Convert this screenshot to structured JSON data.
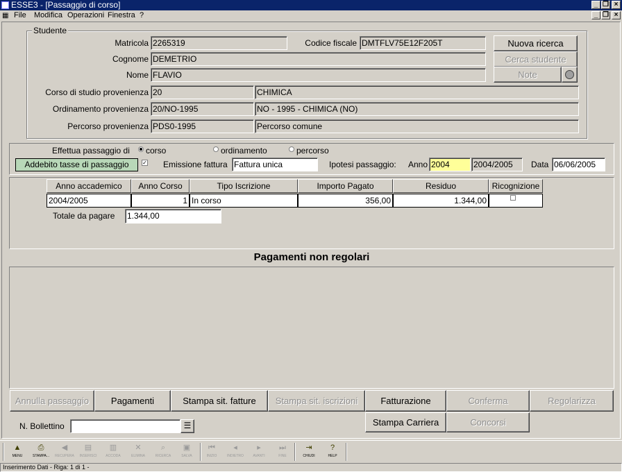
{
  "window": {
    "title": "ESSE3 - [Passaggio di corso]"
  },
  "menu": {
    "items": [
      "File",
      "Modifica",
      "Operazioni",
      "Finestra",
      "?"
    ]
  },
  "studente": {
    "legend": "Studente",
    "matricola_label": "Matricola",
    "matricola": "2265319",
    "cf_label": "Codice fiscale",
    "cf": "DMTFLV75E12F205T",
    "cognome_label": "Cognome",
    "cognome": "DEMETRIO",
    "nome_label": "Nome",
    "nome": "FLAVIO",
    "corso_label": "Corso di studio provenienza",
    "corso_code": "20",
    "corso_desc": "CHIMICA",
    "ord_label": "Ordinamento provenienza",
    "ord_code": "20/NO-1995",
    "ord_desc": "NO - 1995 - CHIMICA (NO)",
    "perc_label": "Percorso provenienza",
    "perc_code": "PDS0-1995",
    "perc_desc": "Percorso comune",
    "btn_nuova": "Nuova ricerca",
    "btn_cerca": "Cerca studente",
    "btn_note": "Note"
  },
  "passaggio": {
    "effettua_label": "Effettua passaggio di",
    "radio_corso": "corso",
    "radio_ord": "ordinamento",
    "radio_perc": "percorso",
    "addebito_label": "Addebito tasse di passaggio",
    "emissione_label": "Emissione fattura",
    "emissione": "Fattura unica",
    "ipotesi_label": "Ipotesi passaggio:",
    "anno_label": "Anno",
    "anno": "2004",
    "anno_desc": "2004/2005",
    "data_label": "Data",
    "data": "06/06/2005"
  },
  "grid": {
    "headers": [
      "Anno accademico",
      "Anno Corso",
      "Tipo Iscrizione",
      "Importo Pagato",
      "Residuo",
      "Ricognizione"
    ],
    "row": {
      "anno_acc": "2004/2005",
      "anno_corso": "1",
      "tipo": "In corso",
      "importo": "356,00",
      "residuo": "1.344,00"
    },
    "totale_label": "Totale da pagare",
    "totale": "1.344,00"
  },
  "pagamenti": {
    "title": "Pagamenti non regolari"
  },
  "buttons": {
    "annulla": "Annulla passaggio",
    "pagamenti": "Pagamenti",
    "stampa_fatture": "Stampa sit. fatture",
    "stampa_iscr": "Stampa sit. iscrizioni",
    "fatturazione": "Fatturazione",
    "conferma": "Conferma",
    "regolarizza": "Regolarizza",
    "stampa_carriera": "Stampa Carriera",
    "concorsi": "Concorsi"
  },
  "bollettino": {
    "label": "N. Bollettino",
    "value": ""
  },
  "toolbar": {
    "items": [
      "MENU",
      "STAMPA...",
      "RECUPERA",
      "INSERISCI",
      "ACCODA",
      "ELIMINA",
      "RICERCA",
      "SALVA",
      "INIZIO",
      "INDIETRO",
      "AVANTI",
      "FINE",
      "CHIUDI",
      "HELP"
    ]
  },
  "status": {
    "text": "Inserimento Dati - Riga: 1 di 1 -"
  }
}
